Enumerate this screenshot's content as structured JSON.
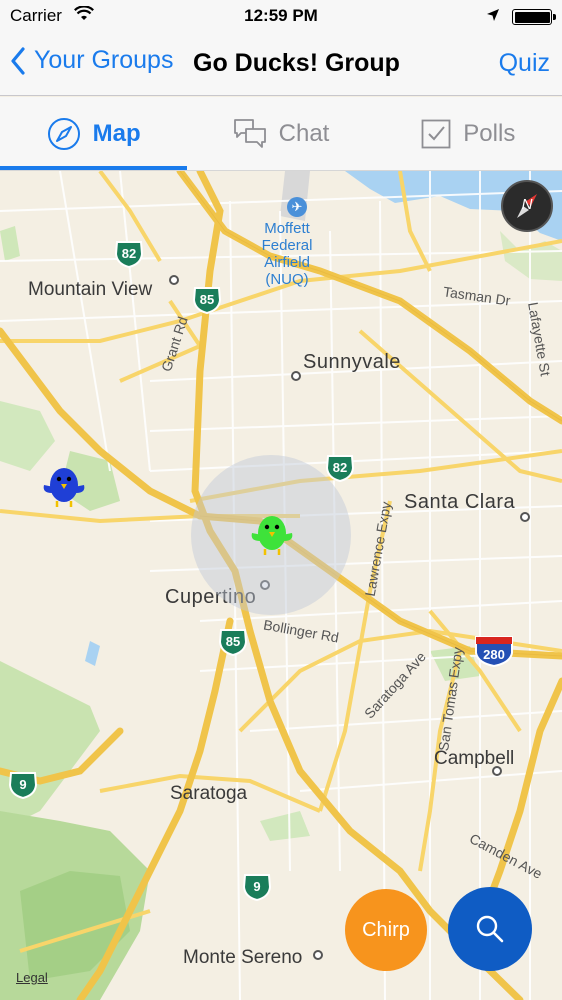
{
  "status_bar": {
    "carrier": "Carrier",
    "time": "12:59 PM"
  },
  "nav": {
    "back_label": "Your Groups",
    "title": "Go Ducks! Group",
    "right_label": "Quiz"
  },
  "tabs": [
    {
      "label": "Map",
      "icon": "compass-icon",
      "active": true
    },
    {
      "label": "Chat",
      "icon": "chat-bubbles-icon",
      "active": false
    },
    {
      "label": "Polls",
      "icon": "checkbox-icon",
      "active": false
    }
  ],
  "map": {
    "places": {
      "mountain_view": "Mountain View",
      "sunnyvale": "Sunnyvale",
      "santa_clara": "Santa Clara",
      "cupertino": "Cupertino",
      "campbell": "Campbell",
      "saratoga": "Saratoga",
      "monte_sereno": "Monte Sereno",
      "airport": "Moffett Federal Airfield (NUQ)"
    },
    "streets": {
      "tasman": "Tasman Dr",
      "lafayette": "Lafayette St",
      "grant": "Grant Rd",
      "lawrence": "Lawrence Expy",
      "bollinger": "Bollinger Rd",
      "saratoga_ave": "Saratoga Ave",
      "san_tomas": "San Tomas Expy",
      "camden": "Camden Ave"
    },
    "shields": {
      "r82a": "82",
      "r85a": "85",
      "r82b": "82",
      "r85b": "85",
      "i280": "280",
      "r9a": "9",
      "r9b": "9"
    },
    "compass_label": "N",
    "legal": "Legal"
  },
  "actions": {
    "chirp": "Chirp"
  },
  "colors": {
    "accent": "#1a7bec",
    "chirp": "#f7941d",
    "search": "#0f5cc4",
    "bird_blue": "#1f3fd6",
    "bird_green": "#3ee23a"
  }
}
